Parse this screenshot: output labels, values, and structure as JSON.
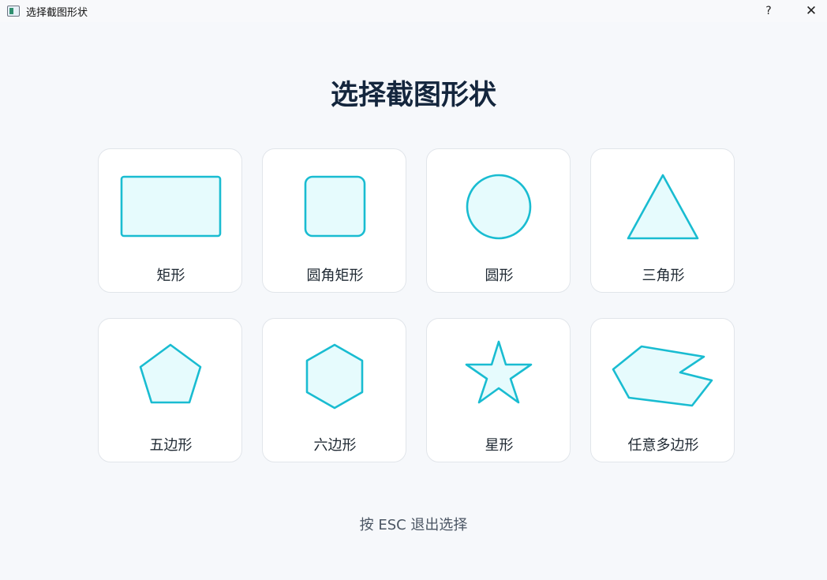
{
  "window": {
    "title": "选择截图形状",
    "help": "?",
    "close": "✕"
  },
  "heading": "选择截图形状",
  "shapes": [
    {
      "id": "rect",
      "label": "矩形"
    },
    {
      "id": "rounded-rect",
      "label": "圆角矩形"
    },
    {
      "id": "circle",
      "label": "圆形"
    },
    {
      "id": "triangle",
      "label": "三角形"
    },
    {
      "id": "pentagon",
      "label": "五边形"
    },
    {
      "id": "hexagon",
      "label": "六边形"
    },
    {
      "id": "star",
      "label": "星形"
    },
    {
      "id": "polygon",
      "label": "任意多边形"
    }
  ],
  "hint": "按 ESC 退出选择",
  "colors": {
    "accent_stroke": "#19bcd1",
    "accent_fill": "#e6fbfd",
    "heading": "#14263d",
    "background": "#f6f8fb"
  }
}
